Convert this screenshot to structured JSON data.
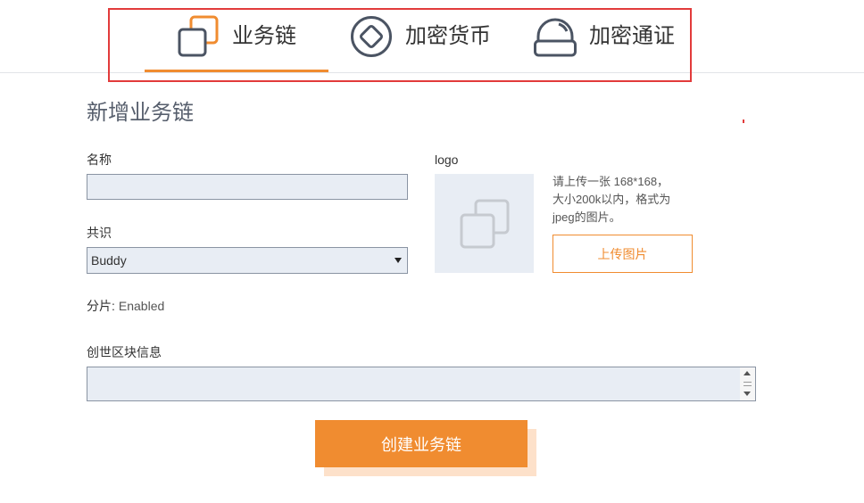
{
  "colors": {
    "accent": "#f08c30",
    "accent_shadow": "#fde1ca",
    "highlight_border": "#e23b3b",
    "field_bg": "#e8edf4",
    "field_border": "#8a94a3",
    "icon_dark": "#4b5463",
    "placeholder_icon": "#c6cad0"
  },
  "tabs": [
    {
      "label": "业务链",
      "icon": "overlapping-squares-icon",
      "active": true
    },
    {
      "label": "加密货币",
      "icon": "diamond-circle-icon",
      "active": false
    },
    {
      "label": "加密通证",
      "icon": "dome-token-icon",
      "active": false
    }
  ],
  "form": {
    "title": "新增业务链",
    "name": {
      "label": "名称",
      "value": ""
    },
    "consensus": {
      "label": "共识",
      "selected": "Buddy"
    },
    "sharding": {
      "label": "分片:",
      "value": "Enabled"
    },
    "genesis": {
      "label": "创世区块信息",
      "value": ""
    },
    "submit_label": "创建业务链"
  },
  "logo": {
    "label": "logo",
    "placeholder_icon": "image-placeholder-icon",
    "hint_lines": [
      "请上传一张 168*168，",
      "大小200k以内，格式为",
      "jpeg的图片。"
    ],
    "upload_label": "上传图片"
  }
}
